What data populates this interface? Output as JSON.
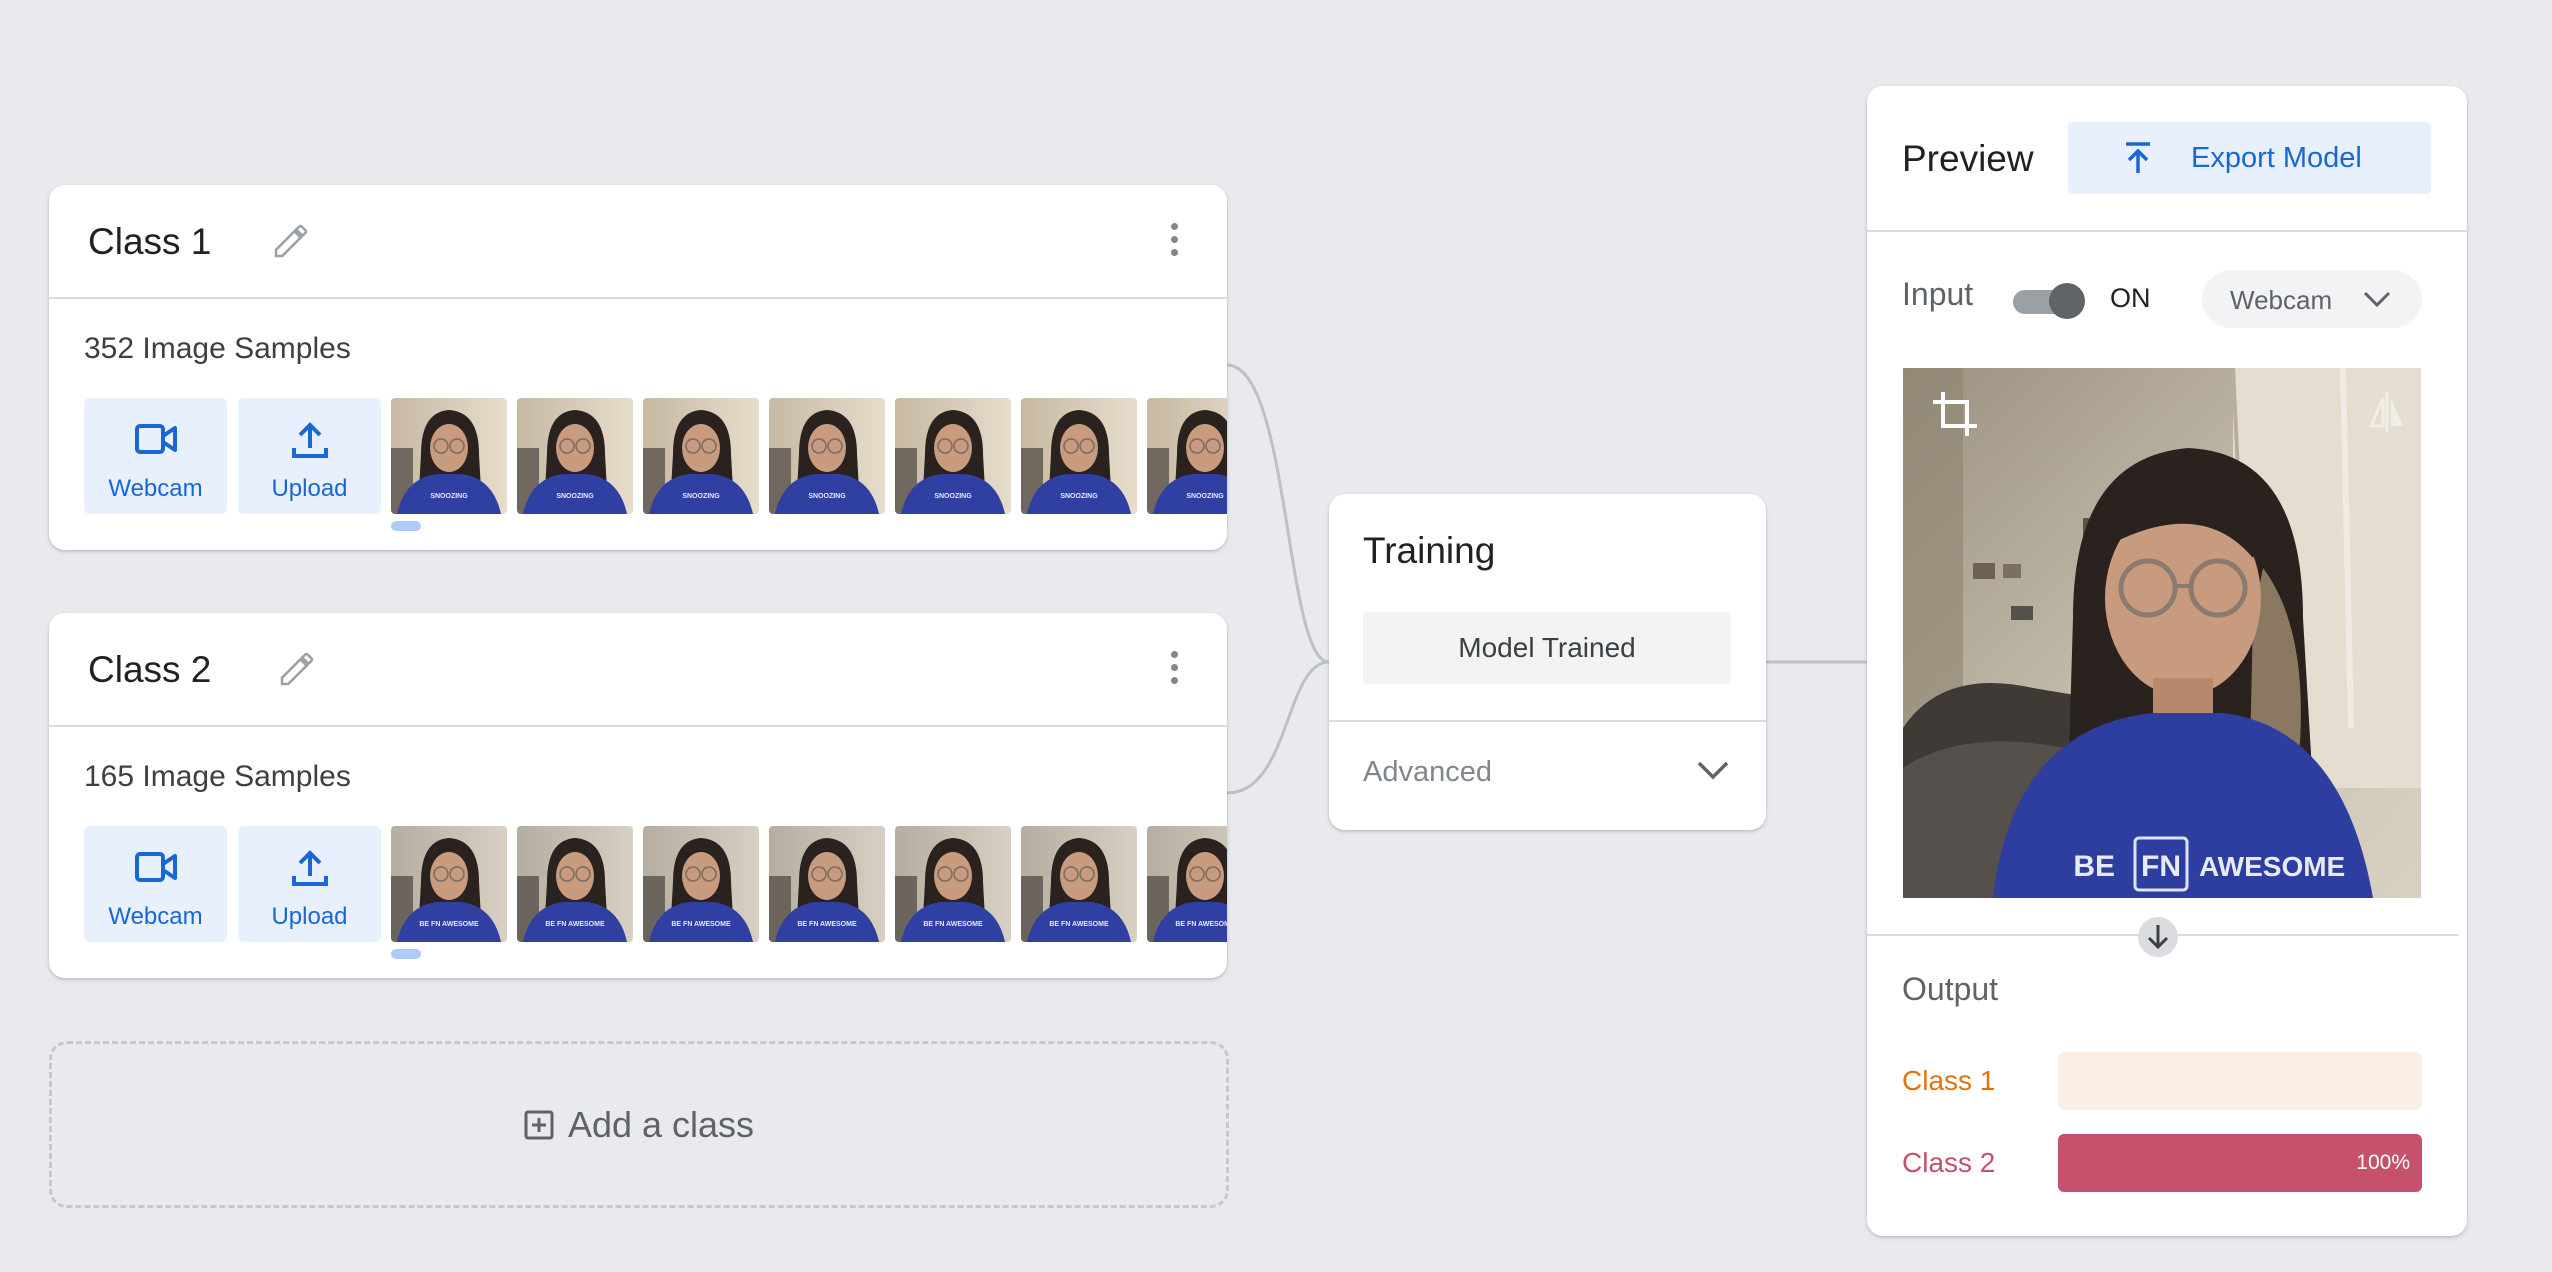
{
  "classes": [
    {
      "name": "Class 1",
      "samples": "352 Image Samples",
      "webcam_label": "Webcam",
      "upload_label": "Upload"
    },
    {
      "name": "Class 2",
      "samples": "165 Image Samples",
      "webcam_label": "Webcam",
      "upload_label": "Upload"
    }
  ],
  "thumb_shirt_text": {
    "class1": "SNOOZING",
    "class2": "BE FN AWESOME"
  },
  "add_class_label": "Add a class",
  "training": {
    "title": "Training",
    "button_label": "Model Trained",
    "advanced_label": "Advanced"
  },
  "preview": {
    "title": "Preview",
    "export_label": "Export Model",
    "input_label": "Input",
    "toggle_state": "ON",
    "source_select": "Webcam",
    "video_shirt_left": "BE",
    "video_shirt_logo": "FN",
    "video_shirt_right": "AWESOME",
    "output_label": "Output",
    "outputs": [
      {
        "label": "Class 1",
        "value": 0,
        "pct_text": "",
        "color": "#e8710a",
        "track": "#fdeee3"
      },
      {
        "label": "Class 2",
        "value": 1.0,
        "pct_text": "100%",
        "color": "#c5516a",
        "track": "#f9e1e6"
      }
    ]
  },
  "colors": {
    "accent": "#1967d2",
    "accent_bg": "#e8f0fe",
    "background": "#e8eaed"
  }
}
